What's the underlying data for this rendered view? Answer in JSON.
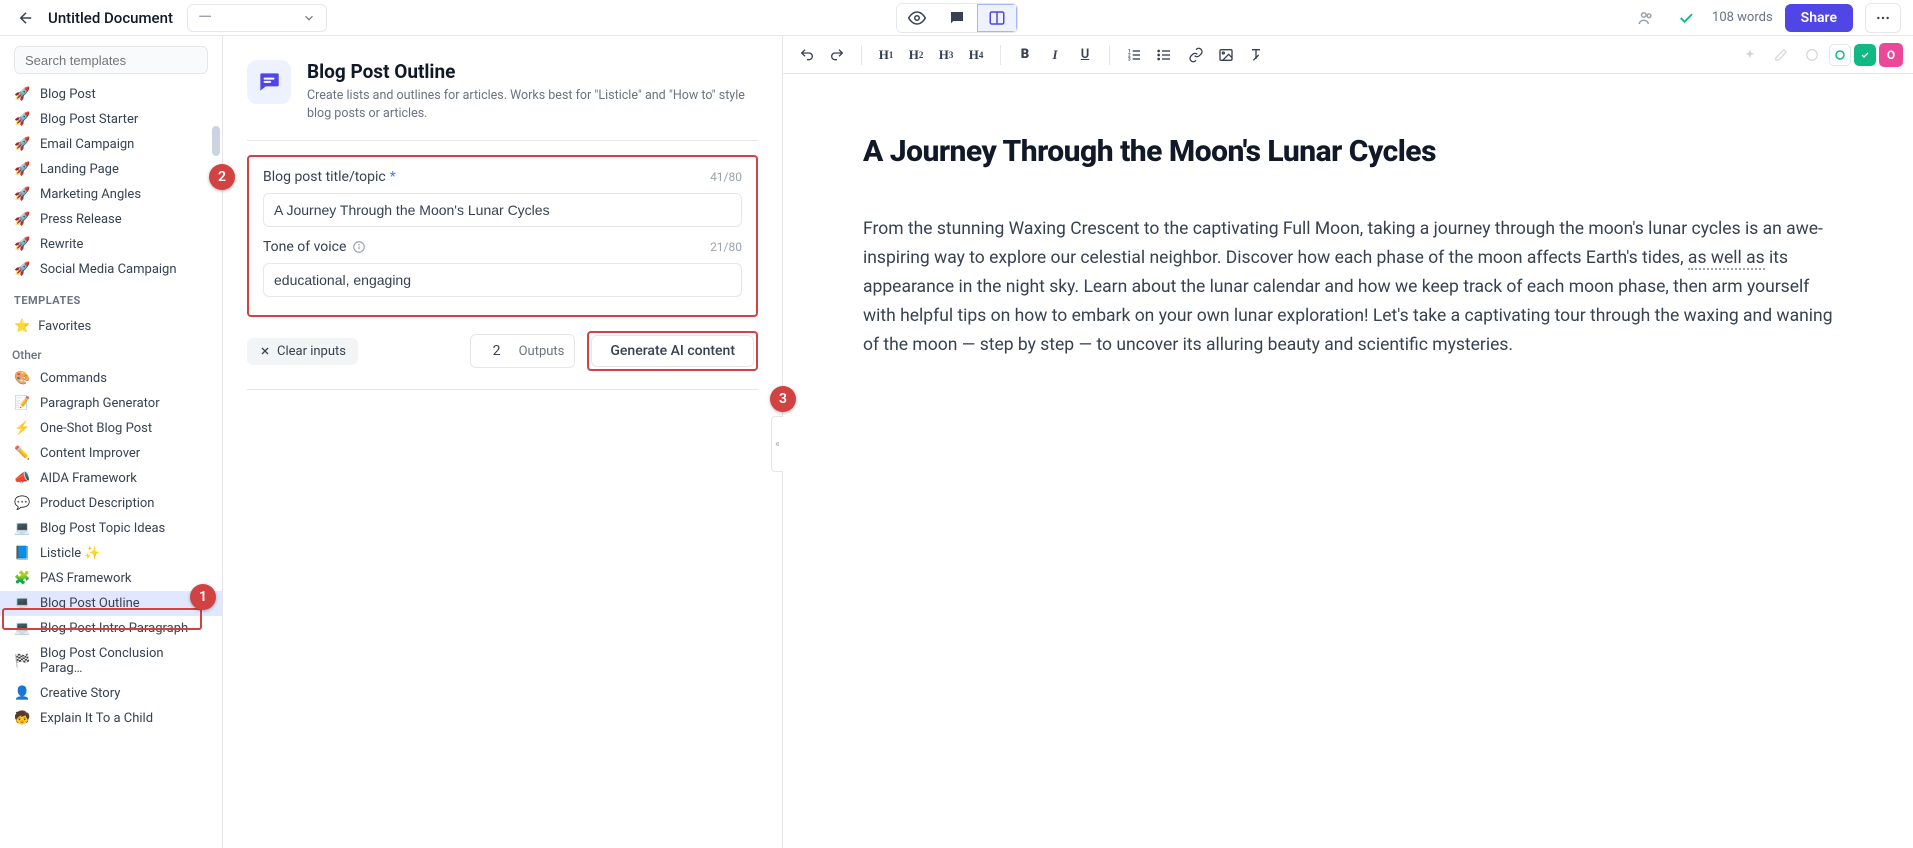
{
  "header": {
    "doc_title": "Untitled Document",
    "status_placeholder": "—",
    "word_count": "108 words",
    "share_label": "Share"
  },
  "sidebar": {
    "search_placeholder": "Search templates",
    "top_items": [
      {
        "icon": "🚀",
        "label": "Blog Post"
      },
      {
        "icon": "🚀",
        "label": "Blog Post Starter"
      },
      {
        "icon": "🚀",
        "label": "Email Campaign"
      },
      {
        "icon": "🚀",
        "label": "Landing Page"
      },
      {
        "icon": "🚀",
        "label": "Marketing Angles"
      },
      {
        "icon": "🚀",
        "label": "Press Release"
      },
      {
        "icon": "🚀",
        "label": "Rewrite"
      },
      {
        "icon": "🚀",
        "label": "Social Media Campaign"
      }
    ],
    "templates_header": "TEMPLATES",
    "favorites_label": "Favorites",
    "other_header": "Other",
    "other_items": [
      {
        "icon": "🎨",
        "label": "Commands"
      },
      {
        "icon": "📝",
        "label": "Paragraph Generator"
      },
      {
        "icon": "⚡",
        "label": "One-Shot Blog Post"
      },
      {
        "icon": "✏️",
        "label": "Content Improver"
      },
      {
        "icon": "📣",
        "label": "AIDA Framework"
      },
      {
        "icon": "💬",
        "label": "Product Description"
      },
      {
        "icon": "💻",
        "label": "Blog Post Topic Ideas"
      },
      {
        "icon": "📘",
        "label": "Listicle ✨"
      },
      {
        "icon": "🧩",
        "label": "PAS Framework"
      },
      {
        "icon": "💻",
        "label": "Blog Post Outline",
        "selected": true
      },
      {
        "icon": "💻",
        "label": "Blog Post Intro Paragraph"
      },
      {
        "icon": "🏁",
        "label": "Blog Post Conclusion Parag…"
      },
      {
        "icon": "👤",
        "label": "Creative Story"
      },
      {
        "icon": "🧒",
        "label": "Explain It To a Child"
      }
    ]
  },
  "template": {
    "title": "Blog Post Outline",
    "description": "Create lists and outlines for articles. Works best for \"Listicle\" and \"How to\" style blog posts or articles.",
    "fields": {
      "title": {
        "label": "Blog post title/topic",
        "value": "A Journey Through the Moon's Lunar Cycles",
        "count": "41/80"
      },
      "tone": {
        "label": "Tone of voice",
        "value": "educational, engaging",
        "count": "21/80"
      }
    },
    "clear_label": "Clear inputs",
    "outputs_value": "2",
    "outputs_label": "Outputs",
    "generate_label": "Generate AI content"
  },
  "markers": {
    "m1": "1",
    "m2": "2",
    "m3": "3"
  },
  "document": {
    "heading": "A Journey Through the Moon's Lunar Cycles",
    "body_before": "From the stunning Waxing Crescent to the captivating Full Moon, taking a journey through the moon's lunar cycles is an awe-inspiring way to explore our celestial neighbor. Discover how each phase of the moon affects Earth's tides, ",
    "body_hl": "as well as",
    "body_after": " its appearance in the night sky. Learn about the lunar calendar and how we keep track of each moon phase, then arm yourself with helpful tips on how to embark on your own lunar exploration! Let's take a captivating tour through the waxing and waning of the moon — step by step — to uncover its alluring beauty and scientific mysteries."
  },
  "avatar_letter": "O"
}
